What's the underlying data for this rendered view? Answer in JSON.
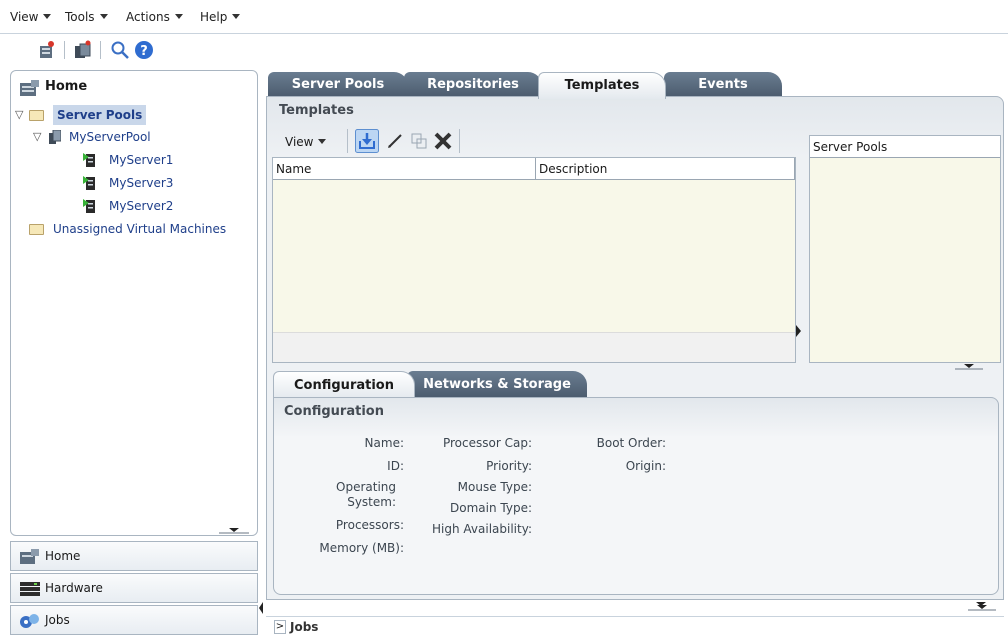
{
  "menubar": {
    "items": [
      {
        "label": "View",
        "mnemonic": "V"
      },
      {
        "label": "Tools",
        "mnemonic": "T"
      },
      {
        "label": "Actions",
        "mnemonic": "A"
      },
      {
        "label": "Help",
        "mnemonic": "H"
      }
    ]
  },
  "toolbar": {
    "icons": [
      "server-create-icon",
      "pool-create-icon",
      "search-icon",
      "help-icon"
    ]
  },
  "nav": {
    "header": "Home",
    "tree": {
      "root": "Server Pools",
      "pool": "MyServerPool",
      "servers": [
        "MyServer1",
        "MyServer3",
        "MyServer2"
      ],
      "unassigned": "Unassigned Virtual Machines"
    },
    "accordion": [
      "Home",
      "Hardware",
      "Jobs"
    ]
  },
  "main": {
    "tabs": [
      "Server Pools",
      "Repositories",
      "Templates",
      "Events"
    ],
    "active_tab": "Templates",
    "section_title": "Templates",
    "view_label": "View",
    "columns": [
      "Name",
      "Description"
    ],
    "server_pools_header": "Server Pools",
    "detail_tabs": [
      "Configuration",
      "Networks & Storage"
    ],
    "detail_title": "Configuration",
    "fields": {
      "col1": [
        "Name:",
        "ID:",
        "Operating",
        "System:",
        "Processors:",
        "Memory (MB):"
      ],
      "col2": [
        "Processor Cap:",
        "Priority:",
        "Mouse Type:",
        "Domain Type:",
        "High Availability:"
      ],
      "col3": [
        "Boot Order:",
        "Origin:"
      ]
    },
    "jobs_label": "Jobs"
  },
  "colors": {
    "tab_dark": "#4a5a6c",
    "link_blue": "#1f3f8a",
    "grid_bg": "#f8f8e9"
  }
}
